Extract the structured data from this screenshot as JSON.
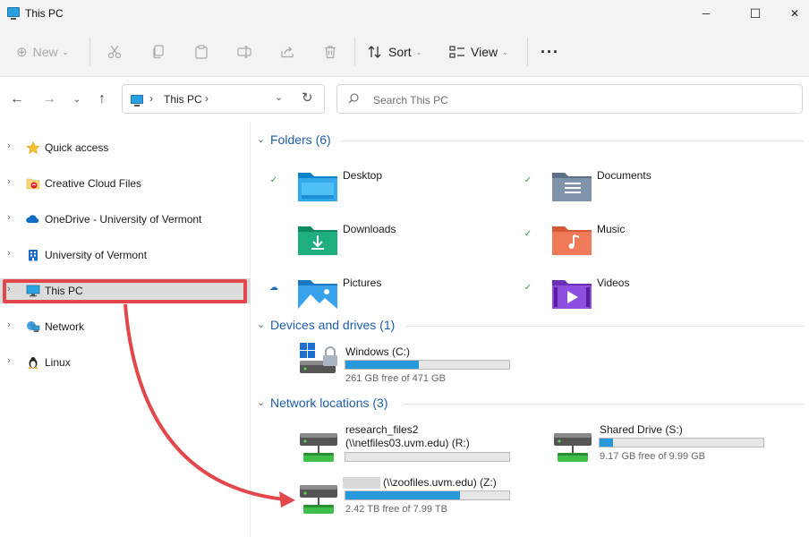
{
  "window": {
    "title": "This PC",
    "controls": {
      "minimize": "─",
      "maximize": "☐",
      "close": "✕"
    }
  },
  "toolbar": {
    "new_label": "New",
    "sort_label": "Sort",
    "view_label": "View",
    "more_label": "···",
    "cut_icon": "cut-icon",
    "copy_icon": "copy-icon",
    "paste_icon": "paste-icon",
    "rename_icon": "rename-icon",
    "share_icon": "share-icon",
    "delete_icon": "delete-icon"
  },
  "address": {
    "path": "This PC",
    "sep1": "›",
    "sep2": "›"
  },
  "search": {
    "placeholder": "Search This PC"
  },
  "sidebar": {
    "items": [
      {
        "label": "Quick access",
        "icon": "star-icon"
      },
      {
        "label": "Creative Cloud Files",
        "icon": "creative-cloud-icon"
      },
      {
        "label": "OneDrive - University of Vermont",
        "icon": "onedrive-icon"
      },
      {
        "label": "University of Vermont",
        "icon": "building-icon"
      },
      {
        "label": "This PC",
        "icon": "computer-icon"
      },
      {
        "label": "Network",
        "icon": "network-icon"
      },
      {
        "label": "Linux",
        "icon": "linux-icon"
      }
    ],
    "selected": "This PC"
  },
  "sections": {
    "folders": "Folders (6)",
    "devices": "Devices and drives (1)",
    "network": "Network locations (3)"
  },
  "folders": [
    {
      "name": "Desktop",
      "status": "synced"
    },
    {
      "name": "Documents",
      "status": "synced"
    },
    {
      "name": "Downloads",
      "status": ""
    },
    {
      "name": "Music",
      "status": "synced"
    },
    {
      "name": "Pictures",
      "status": "cloud"
    },
    {
      "name": "Videos",
      "status": "synced"
    }
  ],
  "drives": [
    {
      "name": "Windows (C:)",
      "free": "261 GB free of 471 GB",
      "used_fraction": 0.45
    }
  ],
  "network_locations": [
    {
      "name_line1": "research_files2",
      "name_line2": "(\\\\netfiles03.uvm.edu) (R:)",
      "free": "",
      "used_fraction": 0
    },
    {
      "name_line1": "Shared Drive (S:)",
      "name_line2": "",
      "free": "9.17 GB free of 9.99 GB",
      "used_fraction": 0.08
    },
    {
      "name_line1": "(\\\\zoofiles.uvm.edu) (Z:)",
      "name_line2": "",
      "free": "2.42 TB free of 7.99 TB",
      "used_fraction": 0.7
    }
  ],
  "colors": {
    "accent": "#1f5ea8",
    "highlight": "#e2484b",
    "bar": "#2798d9",
    "synced": "#2e9b3e"
  }
}
